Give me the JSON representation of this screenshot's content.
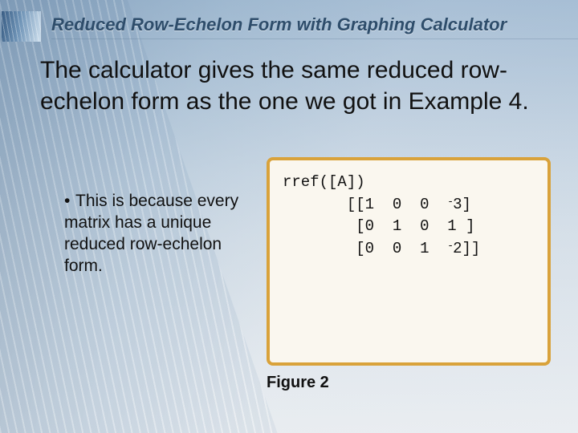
{
  "title": "Reduced Row-Echelon Form with Graphing Calculator",
  "body": "The calculator gives the same reduced row-echelon form as the one we got in Example 4.",
  "bullet": "This is because every matrix has a unique reduced row-echelon form.",
  "calc": {
    "cmd": "rref([A])",
    "rows": [
      {
        "a": "1",
        "b": "0",
        "c": "0",
        "dneg": true,
        "d": "3"
      },
      {
        "a": "0",
        "b": "1",
        "c": "0",
        "dneg": false,
        "d": "1"
      },
      {
        "a": "0",
        "b": "0",
        "c": "1",
        "dneg": true,
        "d": "2"
      }
    ]
  },
  "figure_label": "Figure 2"
}
